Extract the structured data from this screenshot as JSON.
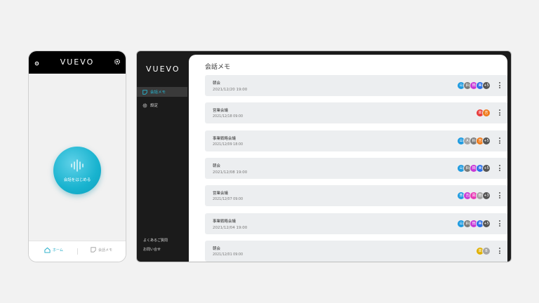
{
  "phone": {
    "logo": "VUEVO",
    "record_label": "会話をはじめる",
    "nav": {
      "home": "ホーム",
      "memo": "会話メモ"
    }
  },
  "desktop": {
    "logo": "VUEVO",
    "sidebar": {
      "items": [
        {
          "label": "会話メモ",
          "icon": "memo-icon"
        },
        {
          "label": "設定",
          "icon": "gear-icon"
        }
      ],
      "links": [
        "よくあるご質問",
        "お問い合せ"
      ]
    },
    "main": {
      "title": "会話メモ",
      "cards": [
        {
          "title": "朝会",
          "date": "2021/12/20 19:00",
          "avatars": [
            {
              "t": "山",
              "c": "#1f9be0"
            },
            {
              "t": "鈴",
              "c": "#7a7a7a"
            },
            {
              "t": "田",
              "c": "#c83ad6"
            },
            {
              "t": "美",
              "c": "#2a6fe8"
            },
            {
              "t": "+5",
              "c": "#555555"
            }
          ]
        },
        {
          "title": "営業会議",
          "date": "2021/12/18 09:00",
          "avatars": [
            {
              "t": "高",
              "c": "#e83a3a"
            },
            {
              "t": "吉",
              "c": "#ef7a1a"
            }
          ]
        },
        {
          "title": "事業戦略会議",
          "date": "2021/12/09 18:00",
          "avatars": [
            {
              "t": "山",
              "c": "#1f9be0"
            },
            {
              "t": "A",
              "c": "#a5a5a5"
            },
            {
              "t": "鈴",
              "c": "#7a7a7a"
            },
            {
              "t": "吉",
              "c": "#ef7a1a"
            },
            {
              "t": "+5",
              "c": "#555555"
            }
          ]
        },
        {
          "title": "朝会",
          "date": "2021/12/08 19:00",
          "avatars": [
            {
              "t": "山",
              "c": "#1f9be0"
            },
            {
              "t": "鈴",
              "c": "#7a7a7a"
            },
            {
              "t": "田",
              "c": "#c83ad6"
            },
            {
              "t": "美",
              "c": "#2a6fe8"
            },
            {
              "t": "+5",
              "c": "#555555"
            }
          ]
        },
        {
          "title": "営業会議",
          "date": "2021/12/07 09:00",
          "avatars": [
            {
              "t": "斎",
              "c": "#1f9be0"
            },
            {
              "t": "吉",
              "c": "#c83ad6"
            },
            {
              "t": "高",
              "c": "#e83ab6"
            },
            {
              "t": "田",
              "c": "#a5a5a5"
            },
            {
              "t": "+3",
              "c": "#555555"
            }
          ]
        },
        {
          "title": "事業戦略会議",
          "date": "2021/12/04 19:00",
          "avatars": [
            {
              "t": "山",
              "c": "#1f9be0"
            },
            {
              "t": "鈴",
              "c": "#7a7a7a"
            },
            {
              "t": "田",
              "c": "#c83ad6"
            },
            {
              "t": "美",
              "c": "#2a6fe8"
            },
            {
              "t": "+5",
              "c": "#555555"
            }
          ]
        },
        {
          "title": "朝会",
          "date": "2021/12/01 09:00",
          "avatars": [
            {
              "t": "高",
              "c": "#e0b000"
            },
            {
              "t": "B",
              "c": "#a5a5a5"
            }
          ]
        }
      ]
    }
  }
}
